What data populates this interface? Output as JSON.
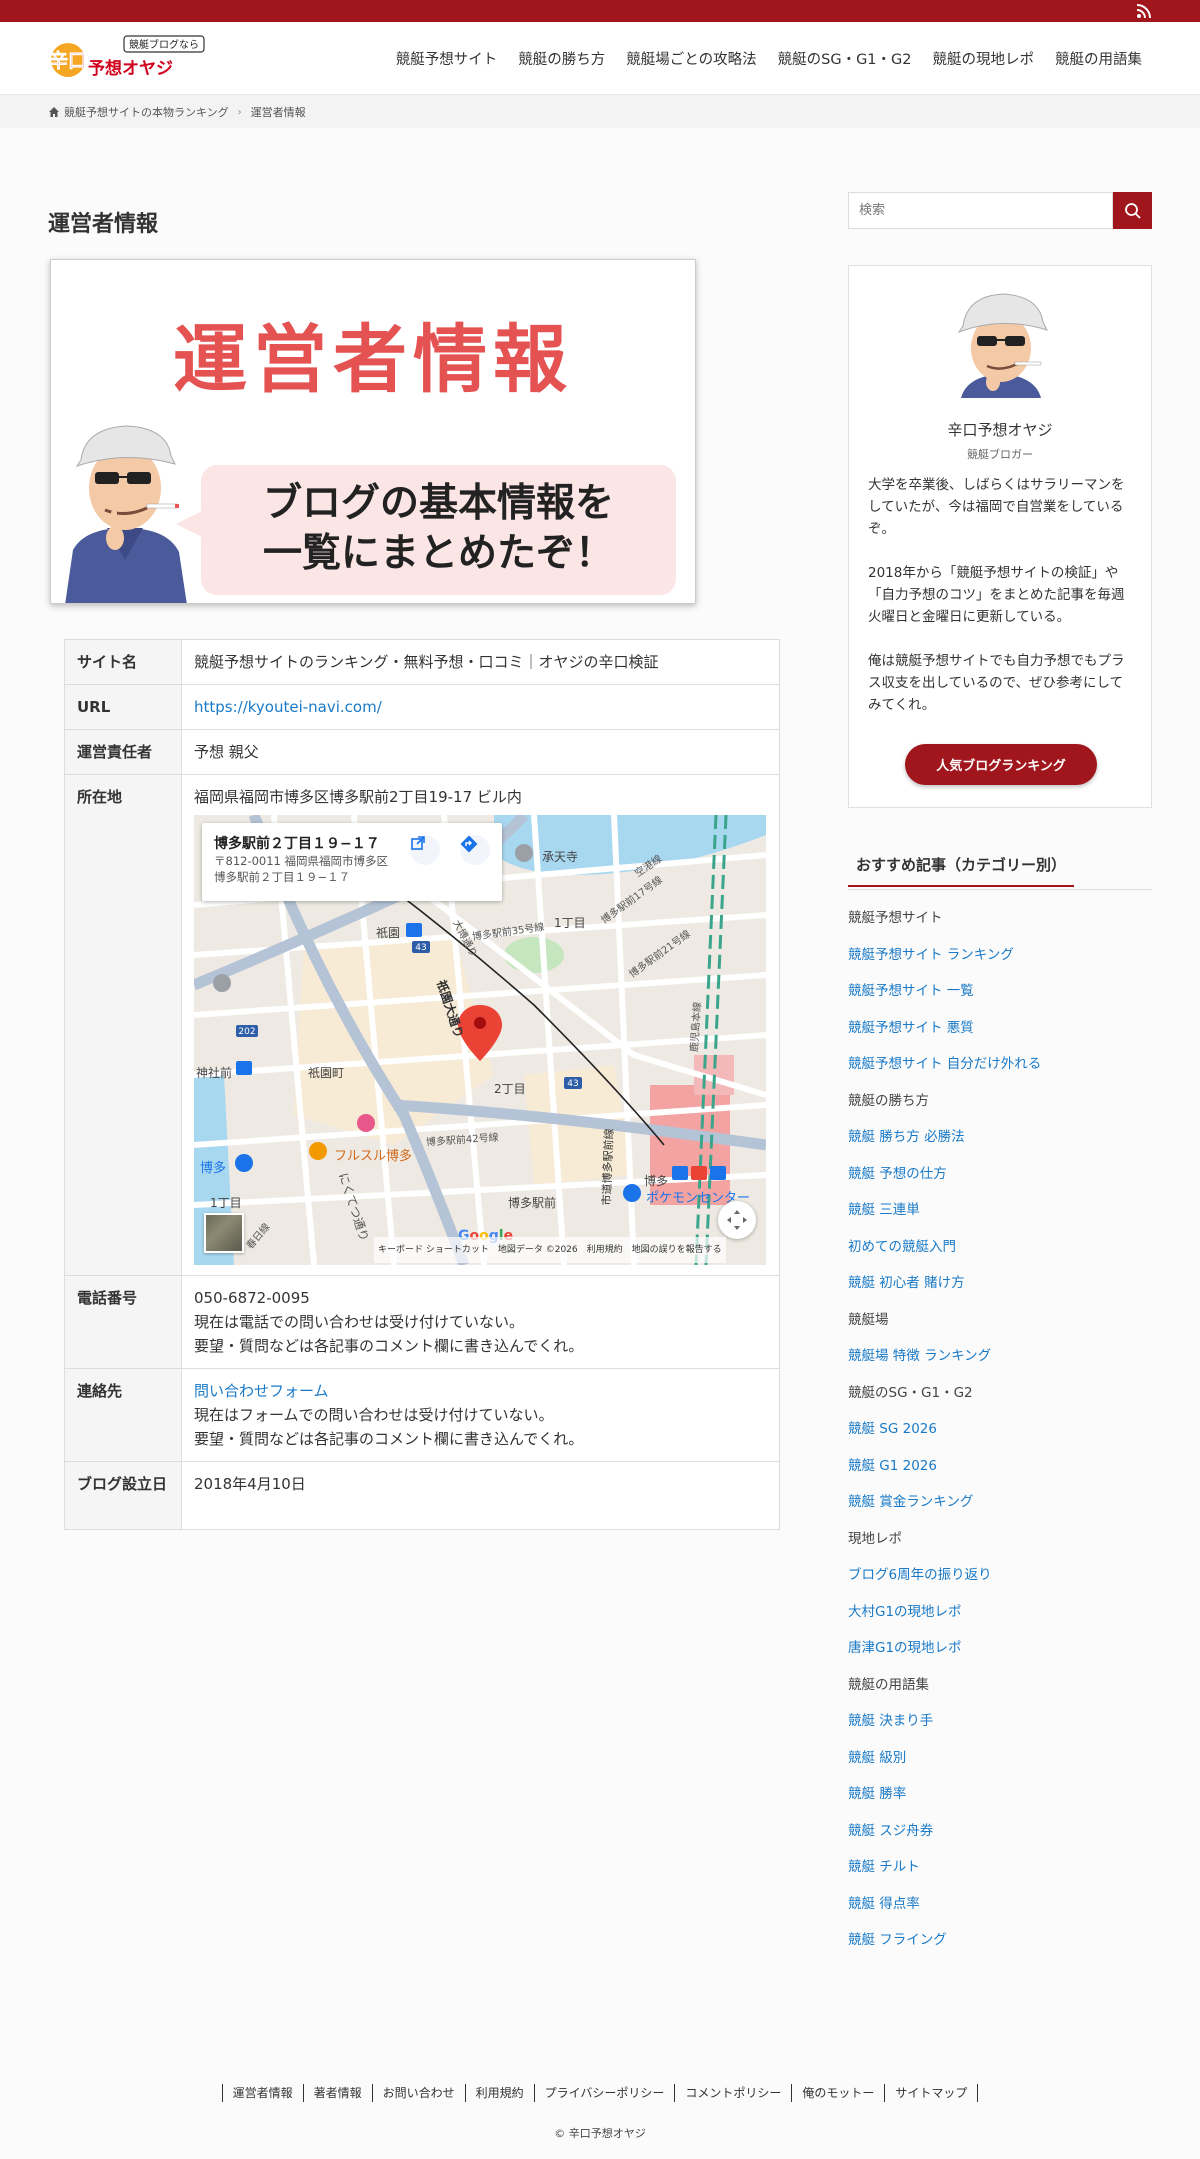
{
  "site": {
    "logo_top": "競艇ブログなら",
    "logo_main": "辛口予想オヤジ",
    "rss_icon": "rss-icon",
    "brand_color": "#a0161c"
  },
  "nav": [
    "競艇予想サイト",
    "競艇の勝ち方",
    "競艇場ごとの攻略法",
    "競艇のSG・G1・G2",
    "競艇の現地レポ",
    "競艇の用語集"
  ],
  "breadcrumb": {
    "home": "競艇予想サイトの本物ランキング",
    "current": "運営者情報"
  },
  "page": {
    "title": "運営者情報",
    "eyecatch_title": "運営者情報",
    "eyecatch_line1": "ブログの基本情報を",
    "eyecatch_line2": "一覧にまとめたぞ！"
  },
  "info": {
    "site_name_label": "サイト名",
    "site_name": "競艇予想サイトのランキング・無料予想・口コミ｜オヤジの辛口検証",
    "url_label": "URL",
    "url": "https://kyoutei-navi.com/",
    "owner_label": "運営責任者",
    "owner": "予想 親父",
    "address_label": "所在地",
    "address": "福岡県福岡市博多区博多駅前2丁目19-17 ビル内",
    "phone_label": "電話番号",
    "phone": "050-6872-0095",
    "phone_note1": "現在は電話での問い合わせは受け付けていない。",
    "phone_note2": "要望・質問などは各記事のコメント欄に書き込んでくれ。",
    "contact_label": "連絡先",
    "contact_link": "問い合わせフォーム",
    "contact_note1": "現在はフォームでの問い合わせは受け付けていない。",
    "contact_note2": "要望・質問などは各記事のコメント欄に書き込んでくれ。",
    "established_label": "ブログ設立日",
    "established": "2018年4月10日"
  },
  "map": {
    "card_title": "博多駅前２丁目１９−１７",
    "card_addr1": "〒812-0011 福岡県福岡市博多区",
    "card_addr2": "博多駅前２丁目１９−１７",
    "labels": {
      "gion": "祇園",
      "gionmachi": "祇園町",
      "jinja": "神社前",
      "hakata_left": "博多",
      "hakata": "博多",
      "hakataekimae": "博多駅前",
      "nichome": "2丁目",
      "icchome": "1丁目",
      "icchome2": "1丁目",
      "shotenji": "承天寺",
      "furusuru": "フルスル博多",
      "pokemon": "ポケモンセンター",
      "gion_dori": "祇園大通り",
      "hakata_ekimae_dori": "市道博多駅前線",
      "taihaku": "大博通り",
      "route_43": "43",
      "route_202": "202",
      "kasuga": "春日線",
      "hakata35": "博多駅前35号線",
      "hakata42": "博多駅前42号線",
      "hakata17": "博多駅前17号線",
      "hakata21": "博多駅前21号線",
      "kagoshima": "鹿児島本線",
      "kuko": "空港線",
      "nikutsu": "にくてつ通り"
    },
    "attribution": "キーボード ショートカット　地図データ ©2026　利用規約　地図の誤りを報告する",
    "google": [
      "G",
      "o",
      "o",
      "g",
      "l",
      "e"
    ]
  },
  "sidebar": {
    "search_placeholder": "検索",
    "profile_name": "辛口予想オヤジ",
    "profile_role": "競艇ブロガー",
    "bio1": "大学を卒業後、しばらくはサラリーマンをしていたが、今は福岡で自営業をしているぞ。",
    "bio2": "2018年から「競艇予想サイトの検証」や「自力予想のコツ」をまとめた記事を毎週火曜日と金曜日に更新している。",
    "bio3": "俺は競艇予想サイトでも自力予想でもプラス収支を出しているので、ぜひ参考にしてみてくれ。",
    "button": "人気ブログランキング",
    "rec_title": "おすすめ記事（カテゴリー別）",
    "rec": [
      {
        "t": "競艇予想サイト",
        "k": "cat"
      },
      {
        "t": "競艇予想サイト ランキング",
        "k": "link"
      },
      {
        "t": "競艇予想サイト 一覧",
        "k": "link"
      },
      {
        "t": "競艇予想サイト 悪質",
        "k": "link"
      },
      {
        "t": "競艇予想サイト 自分だけ外れる",
        "k": "link"
      },
      {
        "t": "競艇の勝ち方",
        "k": "cat"
      },
      {
        "t": "競艇 勝ち方 必勝法",
        "k": "link"
      },
      {
        "t": "競艇 予想の仕方",
        "k": "link"
      },
      {
        "t": "競艇 三連単",
        "k": "link"
      },
      {
        "t": "初めての競艇入門",
        "k": "link"
      },
      {
        "t": "競艇 初心者 賭け方",
        "k": "link"
      },
      {
        "t": "競艇場",
        "k": "cat"
      },
      {
        "t": "競艇場 特徴 ランキング",
        "k": "link"
      },
      {
        "t": "競艇のSG・G1・G2",
        "k": "cat"
      },
      {
        "t": "競艇 SG 2026",
        "k": "link"
      },
      {
        "t": "競艇 G1 2026",
        "k": "link"
      },
      {
        "t": "競艇 賞金ランキング",
        "k": "link"
      },
      {
        "t": "現地レポ",
        "k": "cat"
      },
      {
        "t": "ブログ6周年の振り返り",
        "k": "link"
      },
      {
        "t": "大村G1の現地レポ",
        "k": "link"
      },
      {
        "t": "唐津G1の現地レポ",
        "k": "link"
      },
      {
        "t": "競艇の用語集",
        "k": "cat"
      },
      {
        "t": "競艇 決まり手",
        "k": "link"
      },
      {
        "t": "競艇 級別",
        "k": "link"
      },
      {
        "t": "競艇 勝率",
        "k": "link"
      },
      {
        "t": "競艇 スジ舟券",
        "k": "link"
      },
      {
        "t": "競艇 チルト",
        "k": "link"
      },
      {
        "t": "競艇 得点率",
        "k": "link"
      },
      {
        "t": "競艇 フライング",
        "k": "link"
      }
    ]
  },
  "footer": {
    "links": [
      "運営者情報",
      "著者情報",
      "お問い合わせ",
      "利用規約",
      "プライバシーポリシー",
      "コメントポリシー",
      "俺のモットー",
      "サイトマップ"
    ],
    "copyright": "© 辛口予想オヤジ"
  }
}
